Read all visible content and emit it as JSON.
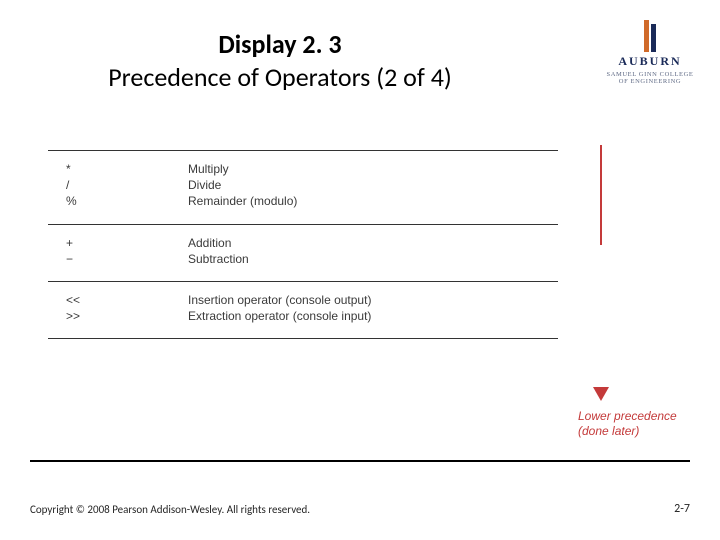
{
  "title": {
    "line1": "Display 2. 3",
    "line2": "Precedence of Operators (2 of 4)"
  },
  "logo": {
    "name": "AUBURN",
    "sub": "SAMUEL GINN COLLEGE OF ENGINEERING"
  },
  "table": {
    "groups": [
      {
        "rows": [
          {
            "sym": "*",
            "desc": "Multiply"
          },
          {
            "sym": "/",
            "desc": "Divide"
          },
          {
            "sym": "%",
            "desc": "Remainder (modulo)"
          }
        ]
      },
      {
        "rows": [
          {
            "sym": "+",
            "desc": "Addition"
          },
          {
            "sym": "−",
            "desc": "Subtraction"
          }
        ]
      },
      {
        "rows": [
          {
            "sym": "<<",
            "desc": "Insertion operator (console output)"
          },
          {
            "sym": ">>",
            "desc": "Extraction operator (console input)"
          }
        ]
      }
    ]
  },
  "arrow": {
    "label_l1": "Lower precedence",
    "label_l2": "(done later)"
  },
  "footer": {
    "copyright": "Copyright © 2008 Pearson Addison-Wesley. All rights reserved.",
    "page": "2-7"
  }
}
